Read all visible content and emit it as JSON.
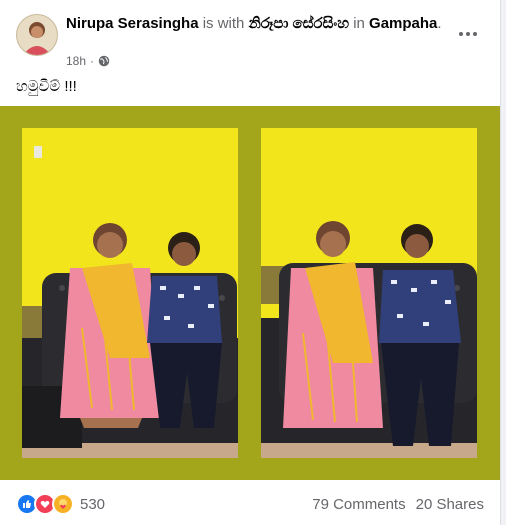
{
  "post": {
    "author": "Nirupa Serasingha",
    "with_text": "is with",
    "tagged": "නිරූපා සේරසිංහ",
    "in_text": "in",
    "place": "Gampaha",
    "place_suffix": ".",
    "time": "18h",
    "caption": "හමුවීම් !!!",
    "privacy_icon": "globe-icon"
  },
  "reactions": {
    "count": "530",
    "icons": [
      "like-icon",
      "love-icon",
      "care-icon"
    ]
  },
  "stats": {
    "comments": "79 Comments",
    "shares": "20 Shares"
  },
  "colors": {
    "photo_frame": "#a3a61a",
    "wall": "#f2e51c",
    "like": "#1877f2",
    "love": "#f33e58",
    "care": "#f7b125"
  }
}
